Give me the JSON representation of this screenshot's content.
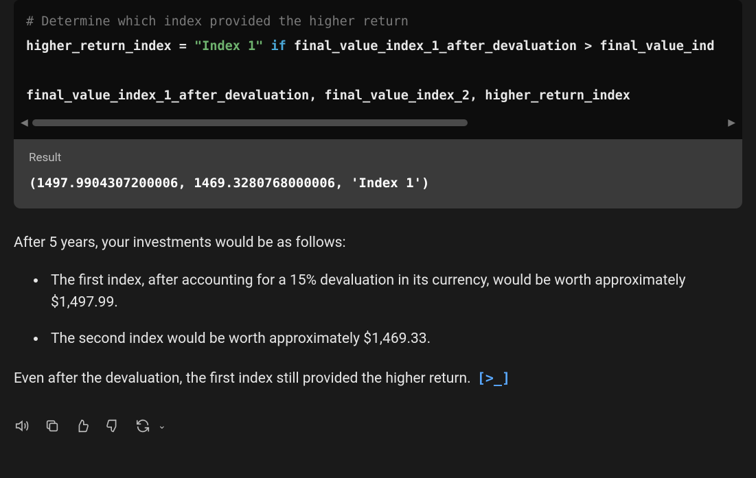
{
  "code": {
    "comment": "# Determine which index provided the higher return",
    "lhs": "higher_return_index",
    "eq": " = ",
    "str": "\"Index 1\"",
    "sp1": " ",
    "if": "if",
    "cond_left": " final_value_index_1_after_devaluation ",
    "gt": ">",
    "cond_right": " final_value_ind",
    "tuple": "final_value_index_1_after_devaluation, final_value_index_2, higher_return_index"
  },
  "result": {
    "label": "Result",
    "value": "(1497.9904307200006, 1469.3280768000006, 'Index 1')"
  },
  "prose": {
    "intro": "After 5 years, your investments would be as follows:",
    "li1": "The first index, after accounting for a 15% devaluation in its currency, would be worth approximately $1,497.99.",
    "li2": "The second index would be worth approximately $1,469.33.",
    "outro": "Even after the devaluation, the first index still provided the higher return.",
    "code_link": "[>_]"
  },
  "icons": {
    "speak": "speak-aloud-icon",
    "copy": "copy-icon",
    "thumbs_up": "thumbs-up-icon",
    "thumbs_down": "thumbs-down-icon",
    "regen": "regenerate-icon",
    "chev": "chevron-down-icon"
  }
}
